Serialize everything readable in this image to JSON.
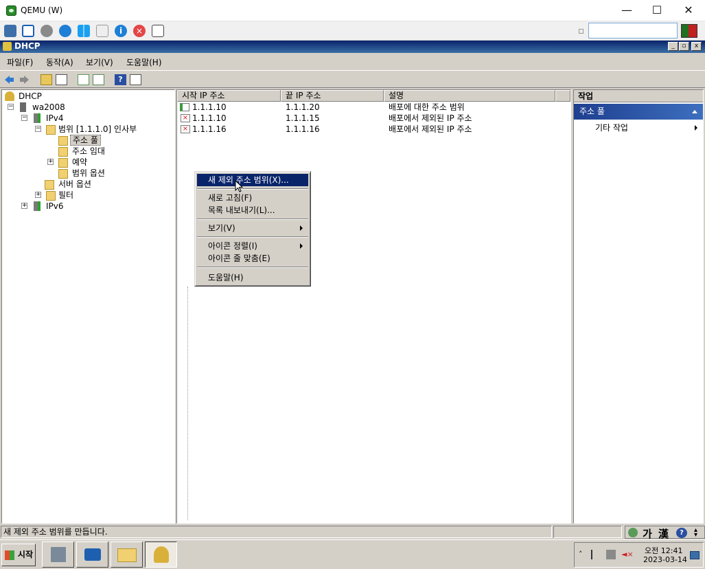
{
  "qemu": {
    "title": "QEMU (W)",
    "minimize": "—",
    "maximize": "☐",
    "close": "✕",
    "search_value": ""
  },
  "mmc": {
    "title": "DHCP",
    "menus": [
      "파일(F)",
      "동작(A)",
      "보기(V)",
      "도움말(H)"
    ]
  },
  "tree": {
    "root": "DHCP",
    "server": "wa2008",
    "ipv4": "IPv4",
    "scope": "범위 [1.1.1.0] 인사부",
    "address_pool": "주소 풀",
    "address_leases": "주소 임대",
    "reservations": "예약",
    "scope_options": "범위 옵션",
    "server_options": "서버 옵션",
    "filters": "필터",
    "ipv6": "IPv6"
  },
  "list": {
    "columns": [
      "시작 IP 주소",
      "끝 IP 주소",
      "설명"
    ],
    "rows": [
      {
        "start": "1.1.1.10",
        "end": "1.1.1.20",
        "desc": "배포에 대한 주소 범위",
        "kind": "range"
      },
      {
        "start": "1.1.1.10",
        "end": "1.1.1.15",
        "desc": "배포에서 제외된 IP 주소",
        "kind": "excluded"
      },
      {
        "start": "1.1.1.16",
        "end": "1.1.1.16",
        "desc": "배포에서 제외된 IP 주소",
        "kind": "excluded"
      }
    ]
  },
  "context_menu": {
    "new_exclusion": "새 제외 주소 범위(X)...",
    "refresh": "새로 고침(F)",
    "export": "목록 내보내기(L)...",
    "view": "보기(V)",
    "arrange": "아이콘 정렬(I)",
    "line_up": "아이콘 줄 맞춤(E)",
    "help": "도움말(H)"
  },
  "actions": {
    "header": "작업",
    "section": "주소 풀",
    "more": "기타 작업"
  },
  "status": {
    "text": "새 제외 주소 범위를 만듭니다.",
    "ime_ga": "가",
    "ime_han": "漢"
  },
  "taskbar": {
    "start": "시작",
    "clock_time": "오전 12:41",
    "clock_date": "2023-03-14"
  },
  "colors": {
    "title_bar": "#0a246a",
    "selection": "#0a246a",
    "face": "#d4d0c8"
  }
}
